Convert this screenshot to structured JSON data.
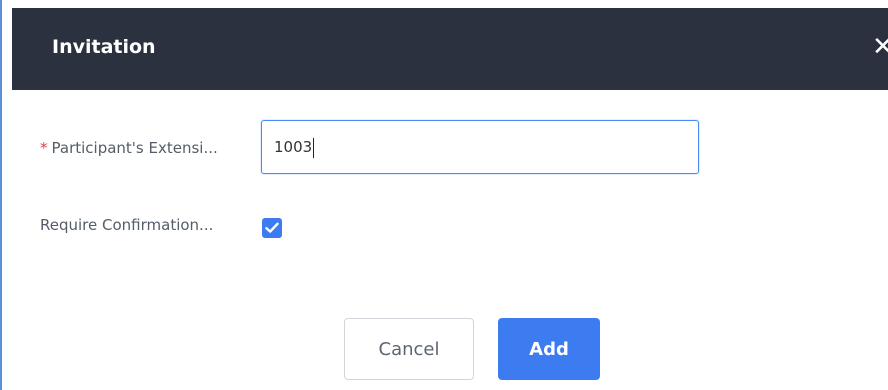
{
  "dialog": {
    "title": "Invitation",
    "close_glyph": "✕"
  },
  "form": {
    "extension": {
      "required_mark": "*",
      "label": "Participant's Extensi...",
      "value": "1003"
    },
    "confirmation": {
      "label": "Require Confirmation...",
      "checked": true
    }
  },
  "buttons": {
    "cancel_label": "Cancel",
    "add_label": "Add"
  },
  "colors": {
    "header_bg": "#2b313e",
    "accent": "#3c7cf0",
    "required": "#e2414a"
  },
  "icons": {
    "close": "close-icon",
    "check": "check-icon"
  }
}
